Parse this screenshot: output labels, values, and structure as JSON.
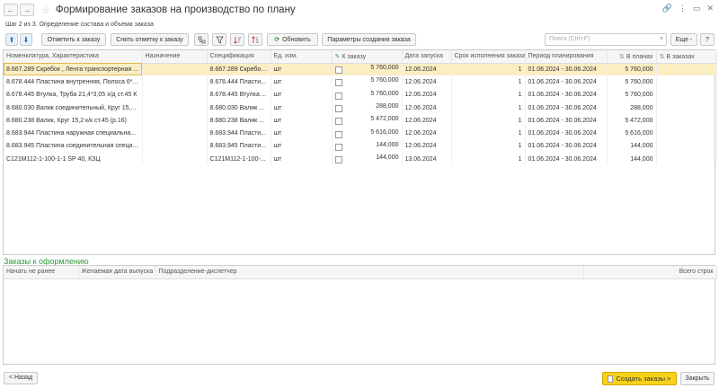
{
  "window": {
    "title": "Формирование заказов на производство по плану",
    "nav_back": "←",
    "nav_forward": "→",
    "star": "☆",
    "link": "🔗",
    "menu": "⋮",
    "restore": "▭",
    "close": "✕"
  },
  "step_text": "Шаг 2 из 3. Определение состава и объема заказа",
  "toolbar": {
    "up": "⬆",
    "down": "⬇",
    "mark_order": "Отметить к заказу",
    "unmark_order": "Снять отметку к заказу",
    "refresh": "Обновить",
    "params": "Параметры создания заказа",
    "search_placeholder": "Поиск (Ctrl+F)",
    "search_clear": "×",
    "more": "Еще -",
    "help": "?"
  },
  "table": {
    "columns": {
      "nomenclature": "Номенклатура, Характеристика",
      "purpose": "Назначение",
      "spec": "Спецификация",
      "unit": "Ед. изм.",
      "to_order": "К заказу",
      "start_date": "Дата запуска",
      "exec_term": "Срок исполнения заказа",
      "period": "Период планирования",
      "in_plans": "В планах",
      "in_orders": "В заказах"
    },
    "rows": [
      {
        "nom": "8.667.289 Скребок , Лента транспортерная ...",
        "purpose": "",
        "spec": "8.667.289 Скребок ...",
        "unit": "шт",
        "qty": "5 760,000",
        "date": "12.06.2024",
        "term": "1",
        "period": "01.06.2024 - 30.06.2024",
        "plans": "5 760,000",
        "orders": ""
      },
      {
        "nom": "8.678.444 Пластина внутренняя, Полоса 6*...",
        "purpose": "",
        "spec": "8.678.444 Пласти...",
        "unit": "шт",
        "qty": "5 760,000",
        "date": "12.06.2024",
        "term": "1",
        "period": "01.06.2024 - 30.06.2024",
        "plans": "5 760,000",
        "orders": ""
      },
      {
        "nom": "8.678.445 Втулка, Труба 21,4*3,05 х/д ст.45 К",
        "purpose": "",
        "spec": "8.678.445 Втулка ...",
        "unit": "шт",
        "qty": "5 760,000",
        "date": "12.06.2024",
        "term": "1",
        "period": "01.06.2024 - 30.06.2024",
        "plans": "5 760,000",
        "orders": ""
      },
      {
        "nom": "8.680.030 Валик соединительный, Круг 15,...",
        "purpose": "",
        "spec": "8.680.030 Валик ...",
        "unit": "шт",
        "qty": "288,000",
        "date": "12.06.2024",
        "term": "1",
        "period": "01.06.2024 - 30.06.2024",
        "plans": "288,000",
        "orders": ""
      },
      {
        "nom": "8.680.238 Валик, Круг 15,2 к/к ст.45 (р.16)",
        "purpose": "",
        "spec": "8.680.238 Валик ...",
        "unit": "шт",
        "qty": "5 472,000",
        "date": "12.06.2024",
        "term": "1",
        "period": "01.06.2024 - 30.06.2024",
        "plans": "5 472,000",
        "orders": ""
      },
      {
        "nom": "8.683.944 Пластина наружная специальна...",
        "purpose": "",
        "spec": "8.683.944 Пласти...",
        "unit": "шт",
        "qty": "5 616,000",
        "date": "12.06.2024",
        "term": "1",
        "period": "01.06.2024 - 30.06.2024",
        "plans": "5 616,000",
        "orders": ""
      },
      {
        "nom": "8.683.945 Пластина соединительная специ...",
        "purpose": "",
        "spec": "8.683.945 Пласти...",
        "unit": "шт",
        "qty": "144,000",
        "date": "12.06.2024",
        "term": "1",
        "period": "01.06.2024 - 30.06.2024",
        "plans": "144,000",
        "orders": ""
      },
      {
        "nom": "С121М112-1-100-1-1 SP 40, КЗЦ",
        "purpose": "",
        "spec": "С121М112-1-100-...",
        "unit": "шт",
        "qty": "144,000",
        "date": "13.06.2024",
        "term": "1",
        "period": "01.06.2024 - 30.06.2024",
        "plans": "144,000",
        "orders": ""
      }
    ]
  },
  "orders_section": {
    "title": "Заказы к оформлению",
    "columns": {
      "start_not_earlier": "Начать не ранее",
      "desired_date": "Желаемая дата выпуска",
      "dispatcher": "Подразделение-диспетчер",
      "total_lines": "Всего строк"
    }
  },
  "footer": {
    "back": "< Назад",
    "create": "Создать заказы >",
    "close": "Закрыть"
  },
  "colors": {
    "accent_green": "#2f9a3a",
    "selected_row": "#fbeec3",
    "primary_button": "#f8d21a"
  }
}
